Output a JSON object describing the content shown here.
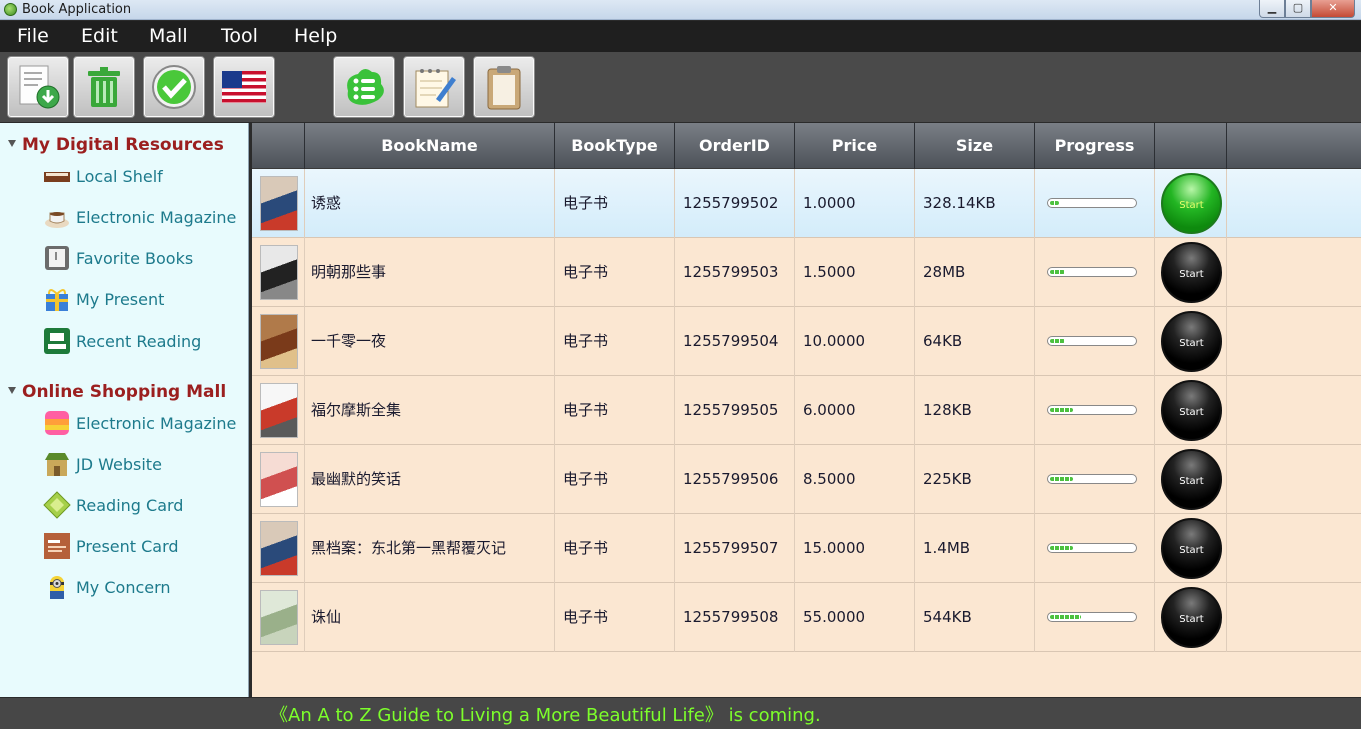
{
  "window": {
    "title": "Book Application"
  },
  "menu": [
    "File",
    "Edit",
    "Mall",
    "Tool",
    "Help"
  ],
  "toolbar": [
    {
      "icon": "download-document-icon"
    },
    {
      "icon": "trash-icon"
    },
    {
      "icon": "check-icon"
    },
    {
      "icon": "us-flag-icon"
    },
    {
      "icon": "list-icon"
    },
    {
      "icon": "notepad-edit-icon"
    },
    {
      "icon": "clipboard-icon"
    }
  ],
  "sidebar": {
    "digital": {
      "title": "My Digital Resources",
      "items": [
        {
          "label": "Local Shelf",
          "icon": "bookshelf-icon"
        },
        {
          "label": "Electronic Magazine",
          "icon": "coffee-cup-icon"
        },
        {
          "label": "Favorite Books",
          "icon": "book-icon"
        },
        {
          "label": "My Present",
          "icon": "gift-icon"
        },
        {
          "label": "Recent Reading",
          "icon": "reader-icon"
        }
      ]
    },
    "mall": {
      "title": "Online Shopping Mall",
      "items": [
        {
          "label": "Electronic Magazine",
          "icon": "color-bars-icon"
        },
        {
          "label": "JD Website",
          "icon": "shop-icon"
        },
        {
          "label": "Reading Card",
          "icon": "card-diamond-icon"
        },
        {
          "label": "Present Card",
          "icon": "present-card-icon"
        },
        {
          "label": "My Concern",
          "icon": "minion-icon"
        }
      ]
    }
  },
  "table": {
    "headers": [
      "",
      "BookName",
      "BookType",
      "OrderID",
      "Price",
      "Size",
      "Progress",
      ""
    ],
    "start_label": "Start",
    "rows": [
      {
        "name": "诱惑",
        "type": "电子书",
        "order": "1255799502",
        "price": "1.0000",
        "size": "328.14KB",
        "progress": 0.1,
        "selected": true
      },
      {
        "name": "明朝那些事",
        "type": "电子书",
        "order": "1255799503",
        "price": "1.5000",
        "size": "28MB",
        "progress": 0.18,
        "selected": false
      },
      {
        "name": "一千零一夜",
        "type": "电子书",
        "order": "1255799504",
        "price": "10.0000",
        "size": "64KB",
        "progress": 0.18,
        "selected": false
      },
      {
        "name": "福尔摩斯全集",
        "type": "电子书",
        "order": "1255799505",
        "price": "6.0000",
        "size": "128KB",
        "progress": 0.27,
        "selected": false
      },
      {
        "name": "最幽默的笑话",
        "type": "电子书",
        "order": "1255799506",
        "price": "8.5000",
        "size": "225KB",
        "progress": 0.27,
        "selected": false
      },
      {
        "name": "黑档案：东北第一黑帮覆灭记",
        "type": "电子书",
        "order": "1255799507",
        "price": "15.0000",
        "size": "1.4MB",
        "progress": 0.27,
        "selected": false
      },
      {
        "name": "诛仙",
        "type": "电子书",
        "order": "1255799508",
        "price": "55.0000",
        "size": "544KB",
        "progress": 0.36,
        "selected": false
      }
    ]
  },
  "status": {
    "message": "《An A to Z Guide to Living a More Beautiful Life》 is coming."
  },
  "colors": {
    "accent_green": "#7dff2b",
    "group_title": "#9b1f1f",
    "sidebar_text": "#1d7a8c"
  }
}
